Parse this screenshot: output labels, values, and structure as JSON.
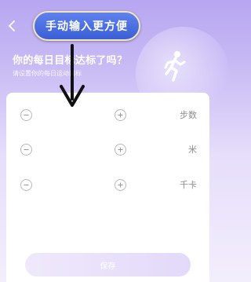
{
  "header": {
    "back_icon": "chevron-left-icon"
  },
  "intro": {
    "title": "你的每日目标达标了吗？",
    "subtitle": "请设置你的每日运动目标",
    "illustration_icon": "runner-icon"
  },
  "goals": [
    {
      "unit": "步数",
      "value": ""
    },
    {
      "unit": "米",
      "value": ""
    },
    {
      "unit": "千卡",
      "value": ""
    }
  ],
  "save_label": "保存",
  "tutorial": {
    "tip_label": "手动输入更方便",
    "arrow_icon": "arrow-down-icon"
  },
  "colors": {
    "accent_purple": "#b7a6f1",
    "tip_blue": "#3a5fd6",
    "save_button_bg": "#e3d9fa"
  }
}
